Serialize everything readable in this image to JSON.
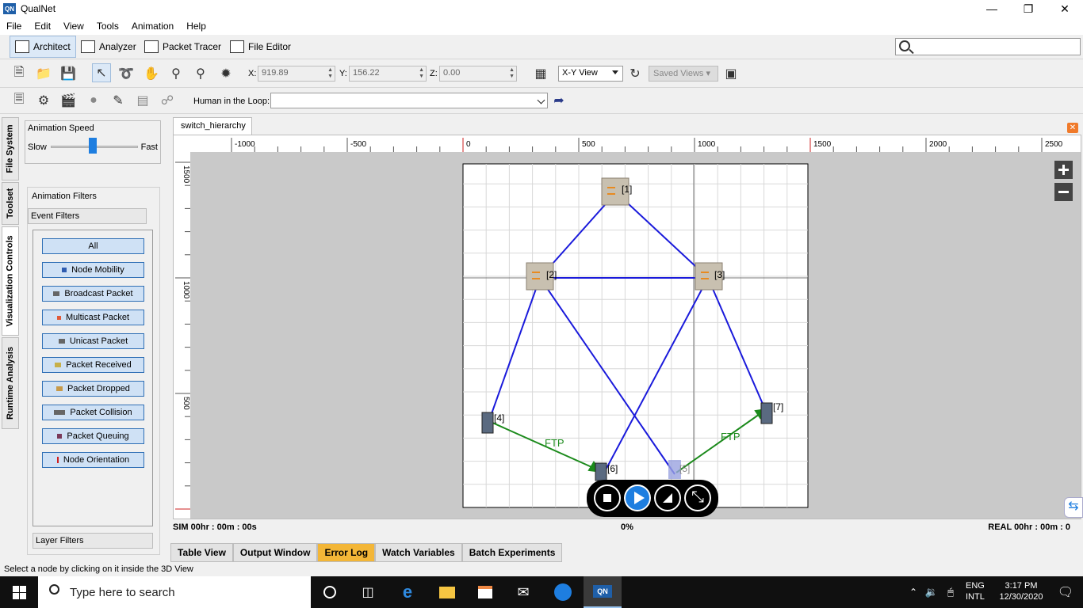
{
  "window": {
    "title": "QualNet",
    "app_icon_text": "QN"
  },
  "menu": [
    "File",
    "Edit",
    "View",
    "Tools",
    "Animation",
    "Help"
  ],
  "mode_tabs": [
    "Architect",
    "Analyzer",
    "Packet Tracer",
    "File Editor"
  ],
  "toolbar": {
    "x_label": "X:",
    "x_value": "919.89",
    "y_label": "Y:",
    "y_value": "156.22",
    "z_label": "Z:",
    "z_value": "0.00",
    "view_select": "X-Y View",
    "saved_views": "Saved Views",
    "hitl_label": "Human in the Loop:",
    "hitl_value": ""
  },
  "vertical_tabs": [
    "File System",
    "Toolset",
    "Visualization Controls",
    "Runtime Analysis"
  ],
  "left_panel": {
    "anim_speed_title": "Animation Speed",
    "slow": "Slow",
    "fast": "Fast",
    "speed_level": 0.5,
    "filters_title": "Animation Filters",
    "event_filters": "Event Filters",
    "layer_filters": "Layer Filters",
    "events": [
      "All",
      "Node Mobility",
      "Broadcast Packet",
      "Multicast Packet",
      "Unicast Packet",
      "Packet Received",
      "Packet Dropped",
      "Packet Collision",
      "Packet Queuing",
      "Node Orientation"
    ]
  },
  "document_tab": "switch_hierarchy",
  "ruler": {
    "x_ticks": [
      "-1000",
      "-500",
      "0",
      "500",
      "1000",
      "1500",
      "2000",
      "2500"
    ],
    "y_ticks": [
      "1500",
      "1000",
      "500"
    ]
  },
  "nodes": [
    {
      "label": "[1]",
      "kind": "switch"
    },
    {
      "label": "[2]",
      "kind": "switch"
    },
    {
      "label": "[3]",
      "kind": "switch"
    },
    {
      "label": "[4]",
      "kind": "host"
    },
    {
      "label": "[5]",
      "kind": "host"
    },
    {
      "label": "[6]",
      "kind": "host"
    },
    {
      "label": "[7]",
      "kind": "host"
    }
  ],
  "flows": [
    {
      "label": "FTP",
      "from": "[4]",
      "to": "[6]"
    },
    {
      "label": "FTP",
      "from": "[5]",
      "to": "[7]"
    }
  ],
  "status": {
    "sim": "SIM 00hr : 00m : 00s",
    "progress": "0%",
    "real": "REAL 00hr : 00m : 0"
  },
  "bottom_tabs": [
    "Table View",
    "Output Window",
    "Error Log",
    "Watch Variables",
    "Batch Experiments"
  ],
  "statusbar": "Select a node by clicking on it inside the 3D View",
  "taskbar": {
    "search_placeholder": "Type here to search",
    "lang_top": "ENG",
    "lang_bottom": "INTL",
    "time": "3:17 PM",
    "date": "12/30/2020"
  },
  "colors": {
    "link": "#1a1adb",
    "flow": "#1b8a1b",
    "accent": "#1e7ee0",
    "error_tab": "#f3b637"
  }
}
